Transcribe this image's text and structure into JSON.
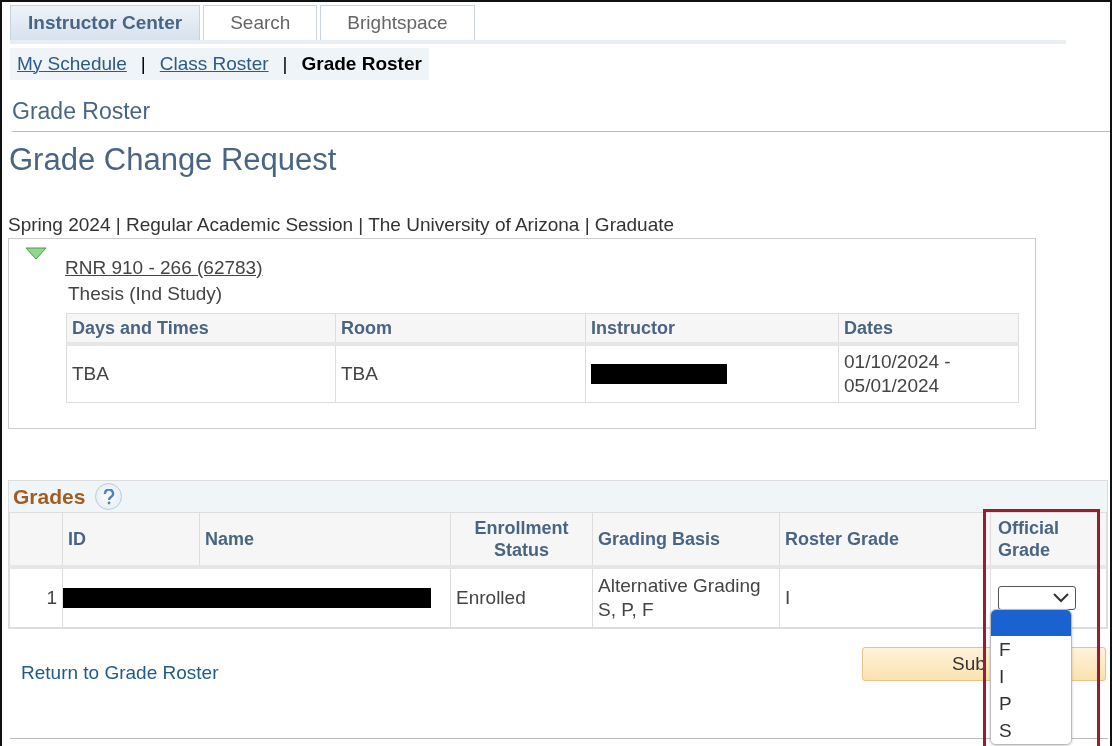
{
  "tabs": [
    {
      "label": "Instructor Center",
      "selected": true
    },
    {
      "label": "Search",
      "selected": false
    },
    {
      "label": "Brightspace",
      "selected": false
    }
  ],
  "subnav": [
    {
      "label": "My Schedule",
      "selected": false
    },
    {
      "label": "Class Roster",
      "selected": false
    },
    {
      "label": "Grade Roster",
      "selected": true
    }
  ],
  "subnav_separator": "|",
  "page_title": "Grade Roster",
  "heading": "Grade Change Request",
  "term": "Spring 2024 | Regular Academic Session | The University of Arizona | Graduate",
  "class_section": {
    "expanded": true,
    "course_link": "RNR 910 - 266 (62783)",
    "description": "Thesis (Ind Study)",
    "columns": [
      "Days and Times",
      "Room",
      "Instructor",
      "Dates"
    ],
    "rows": [
      {
        "days_and_times": "TBA",
        "room": "TBA",
        "instructor_redacted": true,
        "dates": "01/10/2024 - 05/01/2024"
      }
    ]
  },
  "grades": {
    "title": "Grades",
    "columns": [
      "ID",
      "Name",
      "Enrollment Status",
      "Grading Basis",
      "Roster Grade",
      "Official Grade"
    ],
    "rows": [
      {
        "number": "1",
        "redacted": true,
        "enrollment_status": "Enrolled",
        "grading_basis": "Alternative Grading S, P, F",
        "roster_grade": "I",
        "official_grade": {
          "expanded": true,
          "options": [
            {
              "selected": true
            },
            {
              "label": "F",
              "selected": false
            },
            {
              "label": "I",
              "selected": false
            },
            {
              "label": "P",
              "selected": false
            },
            {
              "label": "S",
              "selected": false
            }
          ]
        }
      }
    ]
  },
  "return_link": "Return to Grade Roster",
  "submit_button": "Sub",
  "highlight": true
}
